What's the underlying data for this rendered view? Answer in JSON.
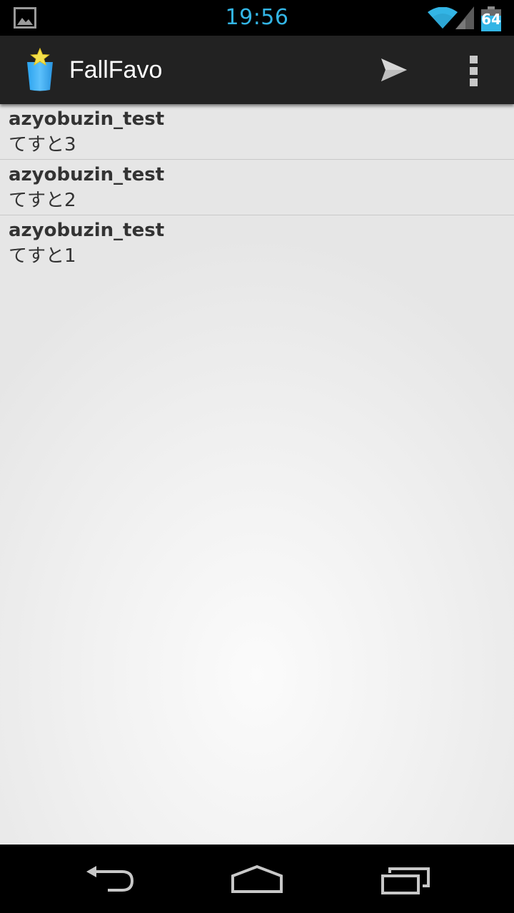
{
  "status_bar": {
    "time": "19:56",
    "battery_level": "64",
    "icons": [
      "gallery-notification-icon",
      "wifi-icon",
      "signal-icon",
      "battery-icon"
    ]
  },
  "action_bar": {
    "app_title": "FallFavo",
    "app_icon": "fallfavo-app-icon",
    "actions": [
      {
        "name": "send-icon"
      },
      {
        "name": "overflow-menu-icon"
      }
    ]
  },
  "tweets": [
    {
      "user": "azyobuzin_test",
      "text": "てすと3"
    },
    {
      "user": "azyobuzin_test",
      "text": "てすと2"
    },
    {
      "user": "azyobuzin_test",
      "text": "てすと1"
    }
  ],
  "nav_bar": {
    "buttons": [
      "back-icon",
      "home-icon",
      "recent-apps-icon"
    ]
  },
  "colors": {
    "accent": "#33b5e5",
    "action_bar": "#222222",
    "list_text": "#333333"
  }
}
